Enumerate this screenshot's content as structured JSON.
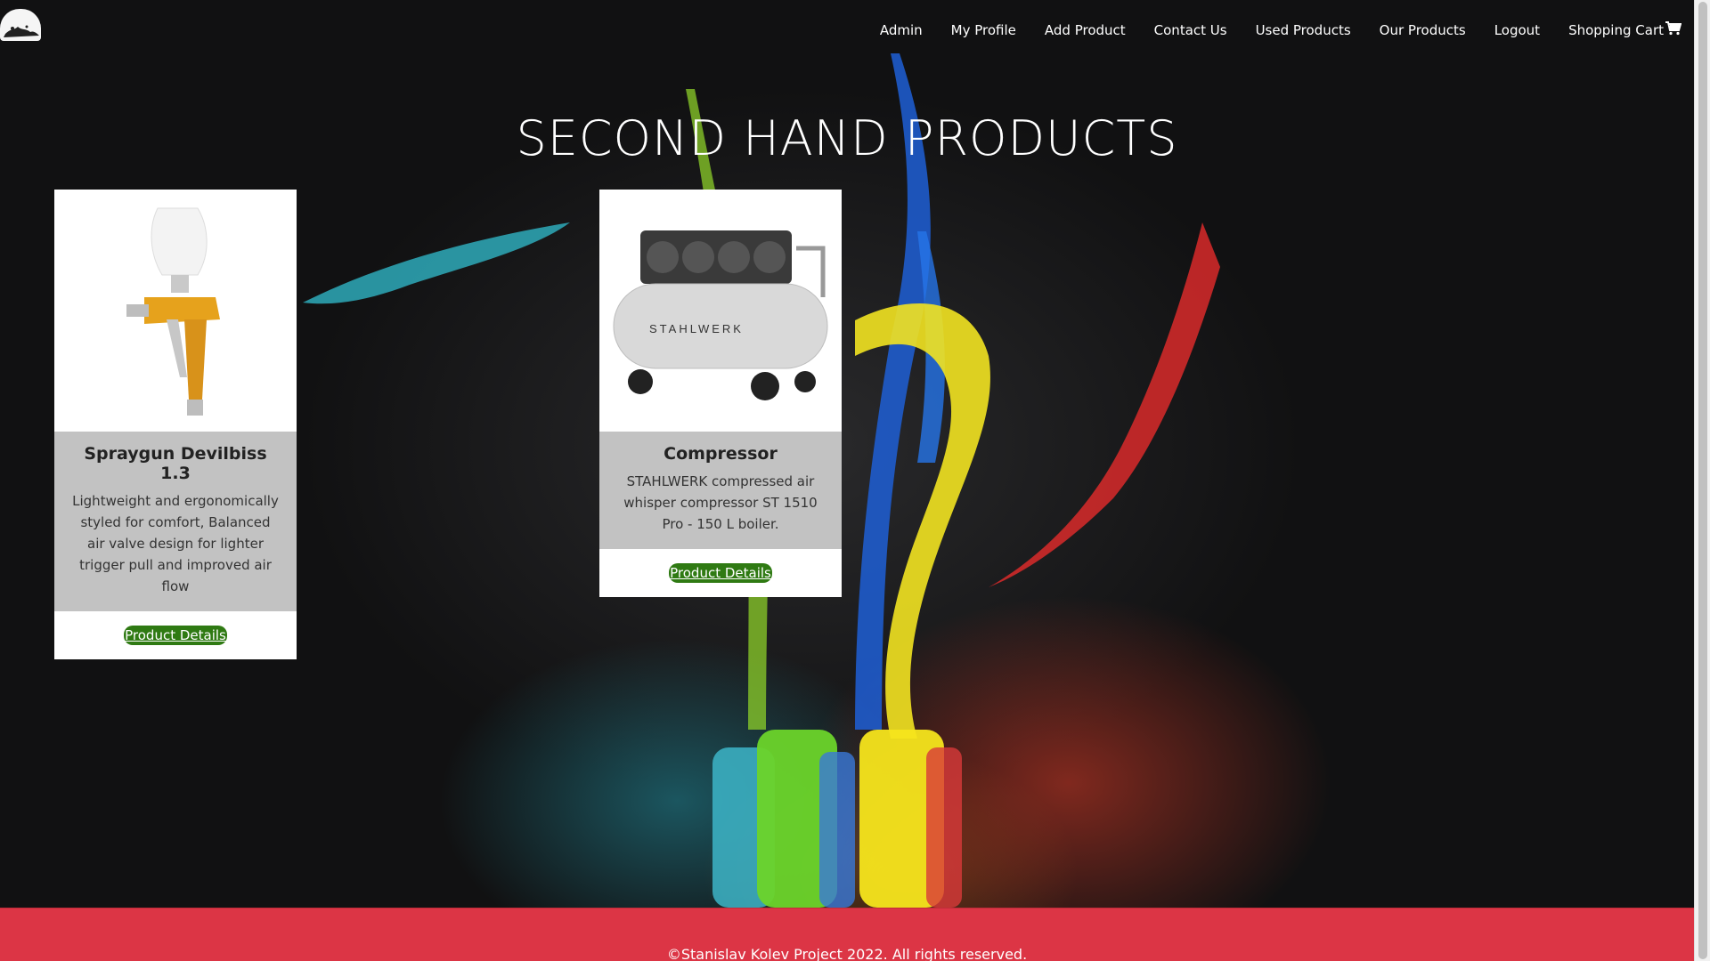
{
  "navbar": {
    "logo": "paint-splash-logo",
    "links": [
      {
        "label": "Admin"
      },
      {
        "label": "My Profile"
      },
      {
        "label": "Add Product"
      },
      {
        "label": "Contact Us"
      },
      {
        "label": "Used Products"
      },
      {
        "label": "Our Products"
      },
      {
        "label": "Logout"
      },
      {
        "label": "Shopping Cart",
        "icon": "shopping-cart-icon"
      }
    ]
  },
  "page": {
    "title": "SECOND HAND PRODUCTS"
  },
  "products": [
    {
      "name": "Spraygun Devilbiss 1.3",
      "description": "Lightweight and ergonomically styled for comfort, Balanced air valve design for lighter trigger pull and improved air flow",
      "button": "Product Details",
      "image": "spray-gun-image"
    },
    {
      "name": "Compressor",
      "description": "STAHLWERK compressed air whisper compressor ST 1510 Pro - 150 L boiler.",
      "button": "Product Details",
      "image": "air-compressor-image",
      "image_label": "STAHLWERK"
    }
  ],
  "footer": {
    "text": "©Stanislav Kolev Project 2022. All rights reserved."
  },
  "colors": {
    "footer_bg": "#dc3545",
    "button_bg": "#2f7a13",
    "page_bg": "#0b0b0c"
  }
}
